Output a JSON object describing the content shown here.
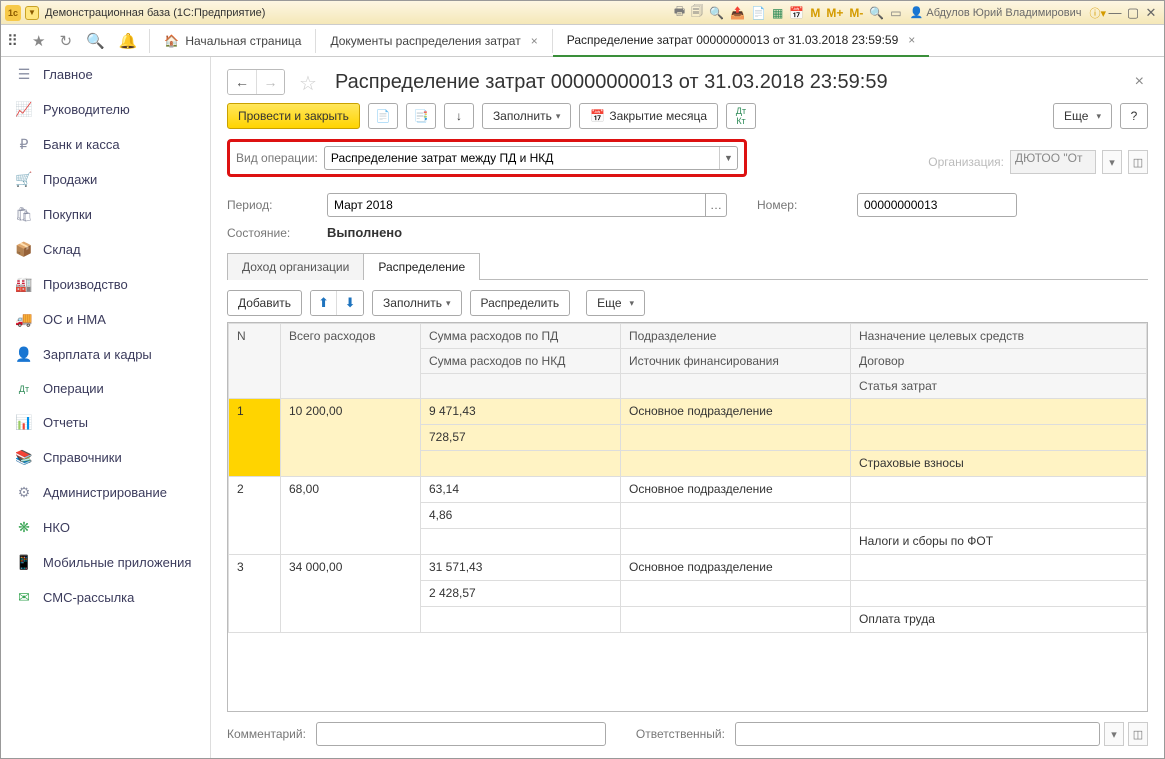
{
  "titlebar": {
    "title": "Демонстрационная база  (1С:Предприятие)",
    "user": "Абдулов Юрий Владимирович",
    "m1": "M",
    "m2": "M+",
    "m3": "M-"
  },
  "navtabs": {
    "home": "Начальная страница",
    "docs": "Документы распределения затрат",
    "current": "Распределение затрат 00000000013 от 31.03.2018 23:59:59"
  },
  "sidebar": {
    "items": [
      {
        "icon": "☰",
        "label": "Главное"
      },
      {
        "icon": "📈",
        "label": "Руководителю"
      },
      {
        "icon": "₽",
        "label": "Банк и касса"
      },
      {
        "icon": "🛒",
        "label": "Продажи"
      },
      {
        "icon": "🛍",
        "label": "Покупки"
      },
      {
        "icon": "📦",
        "label": "Склад"
      },
      {
        "icon": "🏭",
        "label": "Производство"
      },
      {
        "icon": "🚚",
        "label": "ОС и НМА"
      },
      {
        "icon": "👤",
        "label": "Зарплата и кадры"
      },
      {
        "icon": "Дт",
        "label": "Операции"
      },
      {
        "icon": "📊",
        "label": "Отчеты"
      },
      {
        "icon": "📚",
        "label": "Справочники"
      },
      {
        "icon": "⚙",
        "label": "Администрирование"
      },
      {
        "icon": "❋",
        "label": "НКО"
      },
      {
        "icon": "📱",
        "label": "Мобильные приложения"
      },
      {
        "icon": "✉",
        "label": "СМС-рассылка"
      }
    ]
  },
  "doc": {
    "title": "Распределение затрат 00000000013 от 31.03.2018 23:59:59",
    "post_close": "Провести и закрыть",
    "fill": "Заполнить",
    "close_month": "Закрытие месяца",
    "more": "Еще",
    "help": "?",
    "op_label": "Вид операции:",
    "op_value": "Распределение затрат между ПД и НКД",
    "org_label": "Организация:",
    "org_value": "ДЮТОО \"От",
    "period_label": "Период:",
    "period_value": "Март 2018",
    "num_label": "Номер:",
    "num_value": "00000000013",
    "state_label": "Состояние:",
    "state_value": "Выполнено",
    "tabs": {
      "income": "Доход организации",
      "dist": "Распределение"
    },
    "sub": {
      "add": "Добавить",
      "fill": "Заполнить",
      "dist": "Распределить",
      "more": "Еще"
    },
    "cols": {
      "n": "N",
      "total": "Всего расходов",
      "pd": "Сумма расходов по ПД",
      "nkd": "Сумма расходов по НКД",
      "dept": "Подразделение",
      "src": "Источник финансирования",
      "purpose": "Назначение целевых средств",
      "contract": "Договор",
      "cost": "Статья затрат"
    },
    "rows": [
      {
        "n": "1",
        "total": "10 200,00",
        "pd": "9 471,43",
        "nkd": "728,57",
        "dept": "Основное подразделение",
        "src": "",
        "purpose": "",
        "contract": "",
        "cost": "Страховые взносы"
      },
      {
        "n": "2",
        "total": "68,00",
        "pd": "63,14",
        "nkd": "4,86",
        "dept": "Основное подразделение",
        "src": "",
        "purpose": "",
        "contract": "",
        "cost": "Налоги и сборы по ФОТ"
      },
      {
        "n": "3",
        "total": "34 000,00",
        "pd": "31 571,43",
        "nkd": "2 428,57",
        "dept": "Основное подразделение",
        "src": "",
        "purpose": "",
        "contract": "",
        "cost": "Оплата труда"
      }
    ],
    "comment_label": "Комментарий:",
    "resp_label": "Ответственный:"
  }
}
